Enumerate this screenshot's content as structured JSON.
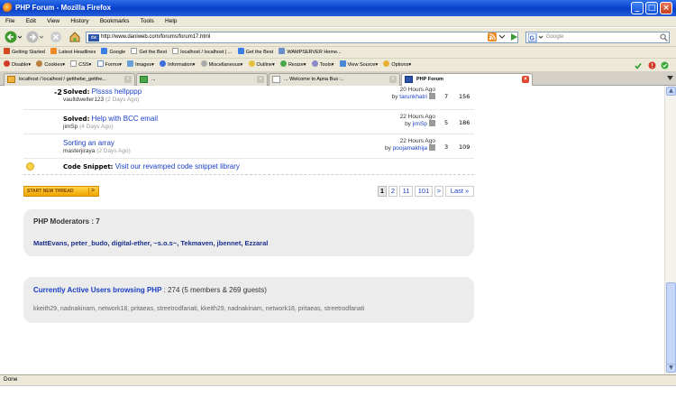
{
  "window": {
    "title": "PHP Forum - Mozilla Firefox"
  },
  "menu": [
    "File",
    "Edit",
    "View",
    "History",
    "Bookmarks",
    "Tools",
    "Help"
  ],
  "nav": {
    "url": "http://www.daniweb.com/forums/forum17.html",
    "url_favicon": "dw",
    "search_placeholder": "Google"
  },
  "bookmarks": [
    "Getting Started",
    "Latest Headlines",
    "Google",
    "Get the Best",
    "localhost / localhost | ...",
    "Get the Best",
    "WAMPSERVER Home..."
  ],
  "devbar": [
    "Disable▾",
    "Cookies▾",
    "CSS▾",
    "Forms▾",
    "Images▾",
    "Information▾",
    "Miscellaneous▾",
    "Outline▾",
    "Resize▾",
    "Tools▾",
    "View Source▾",
    "Options▾"
  ],
  "tabs": [
    {
      "label": "localhost / localhost / getthebe_getthe..."
    },
    {
      "label": "..."
    },
    {
      "label": "... Welcome to Apna Bus :.."
    },
    {
      "label": "PHP Forum"
    }
  ],
  "threads": [
    {
      "rating": "-2",
      "prefix": "Solved:",
      "title": "Plssss hellpppp",
      "author": "vaultdweller123",
      "ago": "(2 Days Ago)",
      "last_post": "20 Hours Ago",
      "last_by": "tarunkhatri",
      "replies": "7",
      "views": "156"
    },
    {
      "rating": "",
      "prefix": "Solved:",
      "title": "Help with BCC email",
      "author": "jimSp",
      "ago": "(4 Days Ago)",
      "last_post": "22 Hours Ago",
      "last_by": "jimSp",
      "replies": "5",
      "views": "186"
    },
    {
      "rating": "",
      "prefix": "",
      "title": "Sorting an array",
      "author": "masterjiraya",
      "ago": "(2 Days Ago)",
      "last_post": "22 Hours Ago",
      "last_by": "poojamakhija",
      "replies": "3",
      "views": "109"
    }
  ],
  "snippet": {
    "prefix": "Code Snippet:",
    "link": "Visit our revamped code snippet library"
  },
  "new_thread_label": "START NEW THREAD",
  "pagination": [
    "1",
    "2",
    "11",
    "101",
    ">",
    "Last »"
  ],
  "moderators": {
    "title": "PHP Moderators : 7",
    "list": "MattEvans, peter_budo, digital-ether, ~s.o.s~, Tekmaven, jbennet, Ezzaral"
  },
  "active": {
    "link": "Currently Active Users browsing PHP",
    "count": ": 274 (5 members & 269 guests)",
    "users": "kkeith29, nadnakinam, network18, pritaeas, streetrodfanati, kkeith29, nadnakinam, network18, pritaeas, streetrodfanati"
  },
  "status": "Done"
}
